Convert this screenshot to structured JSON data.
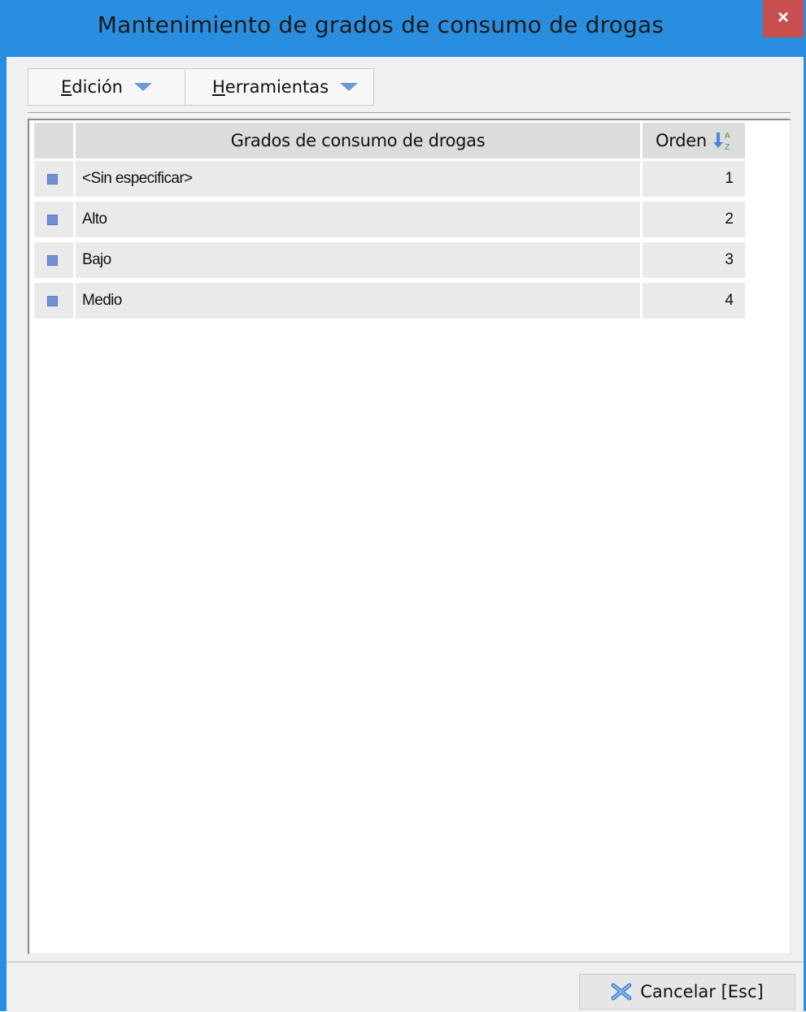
{
  "window": {
    "title": "Mantenimiento de grados de consumo de drogas",
    "close_label": "×"
  },
  "toolbar": {
    "edicion_first": "E",
    "edicion_rest": "dición",
    "herramientas_first": "H",
    "herramientas_rest": "erramientas"
  },
  "grid": {
    "columns": {
      "name": "Grados de consumo de drogas",
      "order": "Orden"
    },
    "rows": [
      {
        "name": "<Sin especificar>",
        "order": "1"
      },
      {
        "name": "Alto",
        "order": "2"
      },
      {
        "name": "Bajo",
        "order": "3"
      },
      {
        "name": "Medio",
        "order": "4"
      }
    ]
  },
  "footer": {
    "cancel_label": "Cancelar [Esc]"
  },
  "icons": {
    "sort": "sort-ascending-az-icon",
    "cancel": "x-cancel-icon",
    "dropdown": "chevron-down-icon",
    "row": "row-indicator-icon"
  },
  "colors": {
    "titlebar": "#2a8ee0",
    "close": "#c94f4f",
    "row_marker": "#6f8fd6"
  }
}
